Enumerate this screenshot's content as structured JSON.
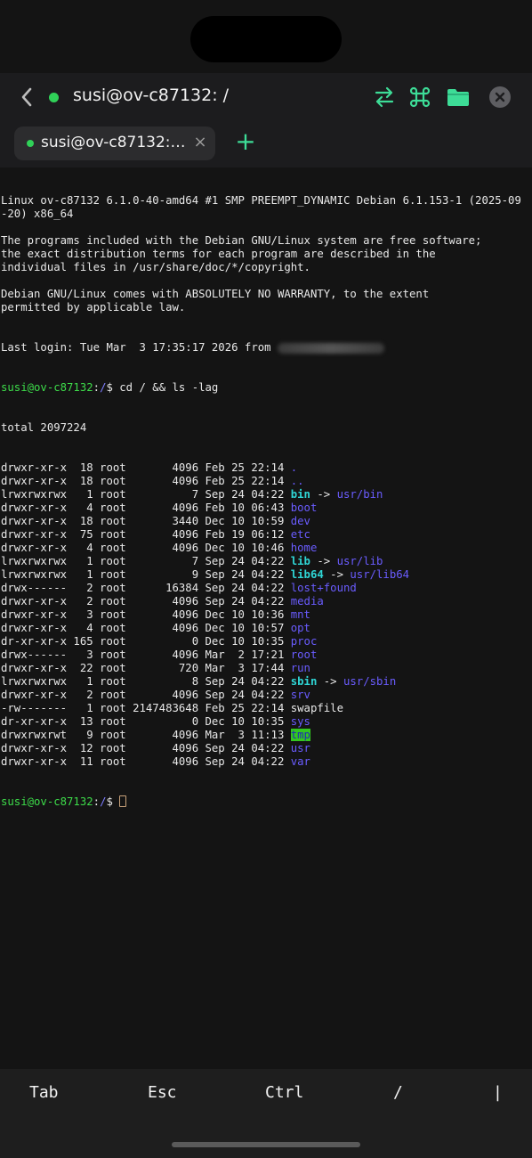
{
  "header": {
    "title": "susi@ov-c87132: /",
    "status_color": "#30d158",
    "icons": [
      "chevron-left-icon",
      "swap-arrows-icon",
      "command-icon",
      "folder-icon",
      "close-circle-icon"
    ]
  },
  "tabs": [
    {
      "label": "susi@ov-c87132:…",
      "close": "×",
      "active": true
    }
  ],
  "tab_add": "+",
  "terminal": {
    "motd": [
      "Linux ov-c87132 6.1.0-40-amd64 #1 SMP PREEMPT_DYNAMIC Debian 6.1.153-1 (2025-09",
      "-20) x86_64",
      "",
      "The programs included with the Debian GNU/Linux system are free software;",
      "the exact distribution terms for each program are described in the",
      "individual files in /usr/share/doc/*/copyright.",
      "",
      "Debian GNU/Linux comes with ABSOLUTELY NO WARRANTY, to the extent",
      "permitted by applicable law."
    ],
    "last_login": "Last login: Tue Mar  3 17:35:17 2026 from ",
    "prompt_user": "susi@ov-c87132",
    "prompt_sep": ":",
    "prompt_path": "/",
    "prompt_end": "$ ",
    "command": "cd / && ls -lag",
    "total": "total 2097224",
    "listing": [
      {
        "meta": "drwxr-xr-x  18 root       4096 Feb 25 22:14 ",
        "name": ".",
        "kind": "dir"
      },
      {
        "meta": "drwxr-xr-x  18 root       4096 Feb 25 22:14 ",
        "name": "..",
        "kind": "dir"
      },
      {
        "meta": "lrwxrwxrwx   1 root          7 Sep 24 04:22 ",
        "name": "bin",
        "kind": "link",
        "target": "usr/bin"
      },
      {
        "meta": "drwxr-xr-x   4 root       4096 Feb 10 06:43 ",
        "name": "boot",
        "kind": "dir"
      },
      {
        "meta": "drwxr-xr-x  18 root       3440 Dec 10 10:59 ",
        "name": "dev",
        "kind": "dir"
      },
      {
        "meta": "drwxr-xr-x  75 root       4096 Feb 19 06:12 ",
        "name": "etc",
        "kind": "dir"
      },
      {
        "meta": "drwxr-xr-x   4 root       4096 Dec 10 10:46 ",
        "name": "home",
        "kind": "dir"
      },
      {
        "meta": "lrwxrwxrwx   1 root          7 Sep 24 04:22 ",
        "name": "lib",
        "kind": "link",
        "target": "usr/lib"
      },
      {
        "meta": "lrwxrwxrwx   1 root          9 Sep 24 04:22 ",
        "name": "lib64",
        "kind": "link",
        "target": "usr/lib64"
      },
      {
        "meta": "drwx------   2 root      16384 Sep 24 04:22 ",
        "name": "lost+found",
        "kind": "dir"
      },
      {
        "meta": "drwxr-xr-x   2 root       4096 Sep 24 04:22 ",
        "name": "media",
        "kind": "dir"
      },
      {
        "meta": "drwxr-xr-x   3 root       4096 Dec 10 10:36 ",
        "name": "mnt",
        "kind": "dir"
      },
      {
        "meta": "drwxr-xr-x   4 root       4096 Dec 10 10:57 ",
        "name": "opt",
        "kind": "dir"
      },
      {
        "meta": "dr-xr-xr-x 165 root          0 Dec 10 10:35 ",
        "name": "proc",
        "kind": "dir"
      },
      {
        "meta": "drwx------   3 root       4096 Mar  2 17:21 ",
        "name": "root",
        "kind": "dir"
      },
      {
        "meta": "drwxr-xr-x  22 root        720 Mar  3 17:44 ",
        "name": "run",
        "kind": "dir"
      },
      {
        "meta": "lrwxrwxrwx   1 root          8 Sep 24 04:22 ",
        "name": "sbin",
        "kind": "link",
        "target": "usr/sbin"
      },
      {
        "meta": "drwxr-xr-x   2 root       4096 Sep 24 04:22 ",
        "name": "srv",
        "kind": "dir"
      },
      {
        "meta": "-rw-------   1 root 2147483648 Feb 25 22:14 ",
        "name": "swapfile",
        "kind": "file"
      },
      {
        "meta": "dr-xr-xr-x  13 root          0 Dec 10 10:35 ",
        "name": "sys",
        "kind": "dir"
      },
      {
        "meta": "drwxrwxrwt   9 root       4096 Mar  3 11:13 ",
        "name": "tmp",
        "kind": "sticky"
      },
      {
        "meta": "drwxr-xr-x  12 root       4096 Sep 24 04:22 ",
        "name": "usr",
        "kind": "dir"
      },
      {
        "meta": "drwxr-xr-x  11 root       4096 Sep 24 04:22 ",
        "name": "var",
        "kind": "dir"
      }
    ],
    "arrow": " -> ",
    "colors": {
      "prompt_user": "#3ddc4a",
      "prompt_path": "#7d7dff",
      "dir": "#6a5cff",
      "link": "#2fd6d6",
      "sticky_bg": "#33c61f"
    }
  },
  "keybar": {
    "keys": [
      "Tab",
      "Esc",
      "Ctrl",
      "/",
      "|"
    ]
  }
}
